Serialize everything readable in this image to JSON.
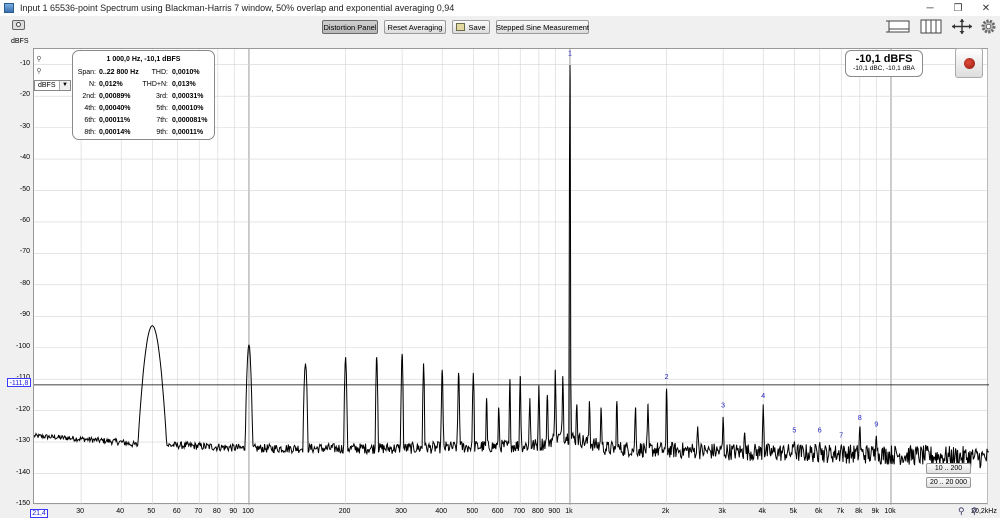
{
  "window": {
    "title": "Input 1 65536-point Spectrum using Blackman-Harris 7 window, 50% overlap and exponential averaging 0,94",
    "minimize": "─",
    "maximize": "❐",
    "close": "✕"
  },
  "toolbar": {
    "distortion_panel": "Distortion Panel",
    "reset_averaging": "Reset Averaging",
    "save": "Save",
    "stepped_sine": "Stepped Sine Measurement"
  },
  "icons": {
    "camera": "camera-icon",
    "graph_layout": "graph-layout-icon",
    "split_view": "split-view-icon",
    "pan_zoom": "pan-zoom-icon",
    "settings": "gear-icon"
  },
  "y_unit_label": "dBFS",
  "unit_selector": "dBFS",
  "cursor_level": "-111,8",
  "x_start": "21,4",
  "distortion": {
    "header": "1 000,0 Hz, -10,1 dBFS",
    "rows": [
      {
        "l1": "Span:",
        "v1": "0..22 800 Hz",
        "l2": "THD:",
        "v2": "0,0010%"
      },
      {
        "l1": "N:",
        "v1": "0,012%",
        "l2": "THD+N:",
        "v2": "0,013%"
      },
      {
        "l1": "2nd:",
        "v1": "0,00089%",
        "l2": "3rd:",
        "v2": "0,00031%"
      },
      {
        "l1": "4th:",
        "v1": "0,00040%",
        "l2": "5th:",
        "v2": "0,00010%"
      },
      {
        "l1": "6th:",
        "v1": "0,00011%",
        "l2": "7th:",
        "v2": "0,000081%"
      },
      {
        "l1": "8th:",
        "v1": "0,00014%",
        "l2": "9th:",
        "v2": "0,00011%"
      }
    ]
  },
  "level_meter": {
    "main": "-10,1 dBFS",
    "sub": "-10,1 dBC, -10,1 dBA"
  },
  "zoom_buttons": {
    "range1": "10 .. 200",
    "range2": "20 .. 20 000"
  },
  "colors": {
    "trace": "#000000",
    "harmonic_label": "#2020c0",
    "cursor_line": "#000000",
    "grid_major": "#d4d4d4",
    "grid_minor": "#ececec"
  },
  "chart_data": {
    "type": "line",
    "title": "",
    "xlabel": "",
    "ylabel": "dBFS",
    "xscale": "log",
    "xlim": [
      21.4,
      20200
    ],
    "ylim": [
      -150,
      -5
    ],
    "grid": true,
    "y_ticks": [
      -10,
      -20,
      -30,
      -40,
      -50,
      -60,
      -70,
      -80,
      -90,
      -100,
      -110,
      -120,
      -130,
      -140,
      -150
    ],
    "x_tick_labels": [
      {
        "v": 30,
        "t": "30"
      },
      {
        "v": 40,
        "t": "40"
      },
      {
        "v": 50,
        "t": "50"
      },
      {
        "v": 60,
        "t": "60"
      },
      {
        "v": 70,
        "t": "70"
      },
      {
        "v": 80,
        "t": "80"
      },
      {
        "v": 90,
        "t": "90"
      },
      {
        "v": 100,
        "t": "100"
      },
      {
        "v": 200,
        "t": "200"
      },
      {
        "v": 300,
        "t": "300"
      },
      {
        "v": 400,
        "t": "400"
      },
      {
        "v": 500,
        "t": "500"
      },
      {
        "v": 600,
        "t": "600"
      },
      {
        "v": 700,
        "t": "700"
      },
      {
        "v": 800,
        "t": "800"
      },
      {
        "v": 900,
        "t": "900"
      },
      {
        "v": 1000,
        "t": "1k"
      },
      {
        "v": 2000,
        "t": "2k"
      },
      {
        "v": 3000,
        "t": "3k"
      },
      {
        "v": 4000,
        "t": "4k"
      },
      {
        "v": 5000,
        "t": "5k"
      },
      {
        "v": 6000,
        "t": "6k"
      },
      {
        "v": 7000,
        "t": "7k"
      },
      {
        "v": 8000,
        "t": "8k"
      },
      {
        "v": 9000,
        "t": "9k"
      },
      {
        "v": 10000,
        "t": "10k"
      },
      {
        "v": 20200,
        "t": "20,2kHz"
      }
    ],
    "cursor_y": -111.8,
    "noise_floor": [
      {
        "f": 21.4,
        "db": -128
      },
      {
        "f": 30,
        "db": -129
      },
      {
        "f": 40,
        "db": -130
      },
      {
        "f": 45,
        "db": -131
      },
      {
        "f": 60,
        "db": -131
      },
      {
        "f": 100,
        "db": -132
      },
      {
        "f": 300,
        "db": -132
      },
      {
        "f": 800,
        "db": -131
      },
      {
        "f": 950,
        "db": -128
      },
      {
        "f": 1050,
        "db": -129
      },
      {
        "f": 1300,
        "db": -132
      },
      {
        "f": 3000,
        "db": -133
      },
      {
        "f": 10000,
        "db": -134
      },
      {
        "f": 20200,
        "db": -135
      }
    ],
    "peaks": [
      {
        "f": 50,
        "db": -93,
        "w": 0.045
      },
      {
        "f": 100,
        "db": -99,
        "w": 0.012
      },
      {
        "f": 150,
        "db": -105,
        "w": 0.008
      },
      {
        "f": 200,
        "db": -103,
        "w": 0.006
      },
      {
        "f": 250,
        "db": -103,
        "w": 0.005
      },
      {
        "f": 300,
        "db": -102,
        "w": 0.005
      },
      {
        "f": 350,
        "db": -105,
        "w": 0.004
      },
      {
        "f": 400,
        "db": -107,
        "w": 0.004
      },
      {
        "f": 450,
        "db": -108,
        "w": 0.004
      },
      {
        "f": 500,
        "db": -108,
        "w": 0.004
      },
      {
        "f": 550,
        "db": -116,
        "w": 0.003
      },
      {
        "f": 600,
        "db": -119,
        "w": 0.003
      },
      {
        "f": 650,
        "db": -110,
        "w": 0.003
      },
      {
        "f": 700,
        "db": -109,
        "w": 0.003
      },
      {
        "f": 750,
        "db": -116,
        "w": 0.003
      },
      {
        "f": 800,
        "db": -112,
        "w": 0.003
      },
      {
        "f": 850,
        "db": -115,
        "w": 0.003
      },
      {
        "f": 900,
        "db": -107,
        "w": 0.003
      },
      {
        "f": 950,
        "db": -109,
        "w": 0.003
      },
      {
        "f": 1000,
        "db": -10.1,
        "w": 0.003
      },
      {
        "f": 1050,
        "db": -118,
        "w": 0.003
      },
      {
        "f": 1150,
        "db": -117,
        "w": 0.003
      },
      {
        "f": 1250,
        "db": -119,
        "w": 0.003
      },
      {
        "f": 1400,
        "db": -117,
        "w": 0.003
      },
      {
        "f": 1600,
        "db": -119,
        "w": 0.003
      },
      {
        "f": 1750,
        "db": -118,
        "w": 0.003
      },
      {
        "f": 2000,
        "db": -113,
        "w": 0.003
      },
      {
        "f": 2500,
        "db": -125,
        "w": 0.003
      },
      {
        "f": 3000,
        "db": -122,
        "w": 0.003
      },
      {
        "f": 3500,
        "db": -127,
        "w": 0.003
      },
      {
        "f": 4000,
        "db": -118,
        "w": 0.003
      },
      {
        "f": 5000,
        "db": -130,
        "w": 0.003
      },
      {
        "f": 6000,
        "db": -130,
        "w": 0.003
      },
      {
        "f": 7000,
        "db": -131,
        "w": 0.003
      },
      {
        "f": 8000,
        "db": -125,
        "w": 0.003
      },
      {
        "f": 9000,
        "db": -128,
        "w": 0.003
      }
    ],
    "harmonic_labels": [
      {
        "t": "1",
        "f": 1000,
        "db": -7
      },
      {
        "t": "2",
        "f": 2000,
        "db": -110
      },
      {
        "t": "3",
        "f": 3000,
        "db": -119
      },
      {
        "t": "4",
        "f": 4000,
        "db": -116
      },
      {
        "t": "5",
        "f": 5000,
        "db": -127
      },
      {
        "t": "6",
        "f": 6000,
        "db": -127
      },
      {
        "t": "7",
        "f": 7000,
        "db": -128.5
      },
      {
        "t": "8",
        "f": 8000,
        "db": -123
      },
      {
        "t": "9",
        "f": 9000,
        "db": -125
      }
    ]
  }
}
